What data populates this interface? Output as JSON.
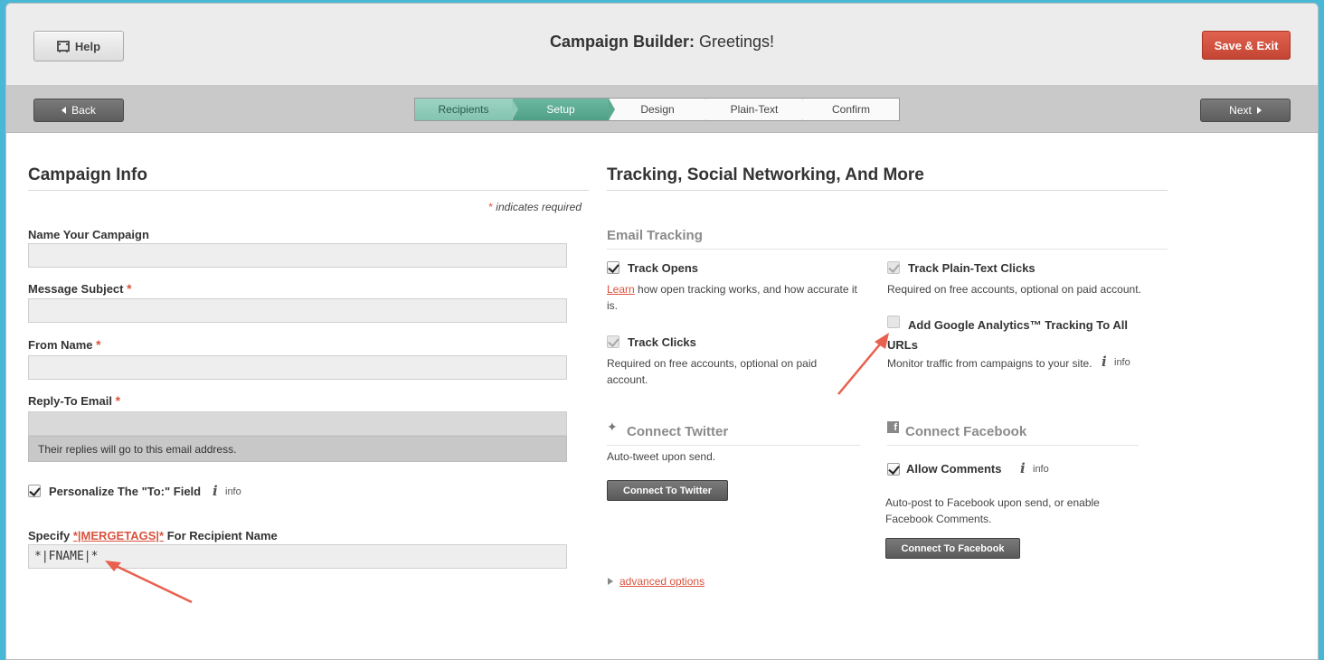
{
  "header": {
    "help_label": "Help",
    "title_bold": "Campaign Builder:",
    "title_rest": " Greetings!",
    "save_exit_label": "Save & Exit"
  },
  "nav": {
    "back_label": "Back",
    "next_label": "Next",
    "steps": [
      {
        "label": "Recipients",
        "state": "done"
      },
      {
        "label": "Setup",
        "state": "active"
      },
      {
        "label": "Design",
        "state": "upcoming"
      },
      {
        "label": "Plain-Text",
        "state": "upcoming"
      },
      {
        "label": "Confirm",
        "state": "upcoming"
      }
    ]
  },
  "campaign_info": {
    "title": "Campaign Info",
    "required_star": "*",
    "required_note": " indicates required",
    "name_label": "Name Your Campaign",
    "name_value": "",
    "subject_label": "Message Subject",
    "subject_value": "",
    "from_label": "From Name",
    "from_value": "",
    "reply_label": "Reply-To Email",
    "reply_value": "",
    "reply_hint": "Their replies will go to this email address.",
    "personalize_label": "Personalize The \"To:\" Field",
    "personalize_checked": true,
    "info_label": "info",
    "mergetags_prefix": "Specify ",
    "mergetags_link": "*|MERGETAGS|*",
    "mergetags_suffix": " For Recipient Name",
    "mergetags_value": "*|FNAME|*"
  },
  "tracking": {
    "title": "Tracking, Social Networking, And More",
    "email_tracking_label": "Email Tracking",
    "track_opens_label": "Track Opens",
    "track_opens_checked": true,
    "learn_link": "Learn",
    "track_opens_desc": " how open tracking works, and how accurate it is.",
    "track_clicks_label": "Track Clicks",
    "track_clicks_desc": "Required on free accounts, optional on paid account.",
    "track_plain_label": "Track Plain-Text Clicks",
    "track_plain_desc": "Required on free accounts, optional on paid account.",
    "ga_label": "Add Google Analytics™ Tracking To All URLs",
    "ga_checked": false,
    "ga_desc": "Monitor traffic from campaigns to your site.",
    "info_label": "info",
    "twitter_label": "Connect Twitter",
    "twitter_desc": "Auto-tweet upon send.",
    "twitter_button": "Connect To Twitter",
    "facebook_label": "Connect Facebook",
    "allow_comments_label": "Allow Comments",
    "allow_comments_checked": true,
    "facebook_desc": "Auto-post to Facebook upon send, or enable Facebook Comments.",
    "facebook_button": "Connect To Facebook",
    "advanced_link": "advanced options"
  },
  "colors": {
    "accent_red": "#d9533f",
    "step_done": "#8ec9b6",
    "step_active": "#5caa91"
  }
}
